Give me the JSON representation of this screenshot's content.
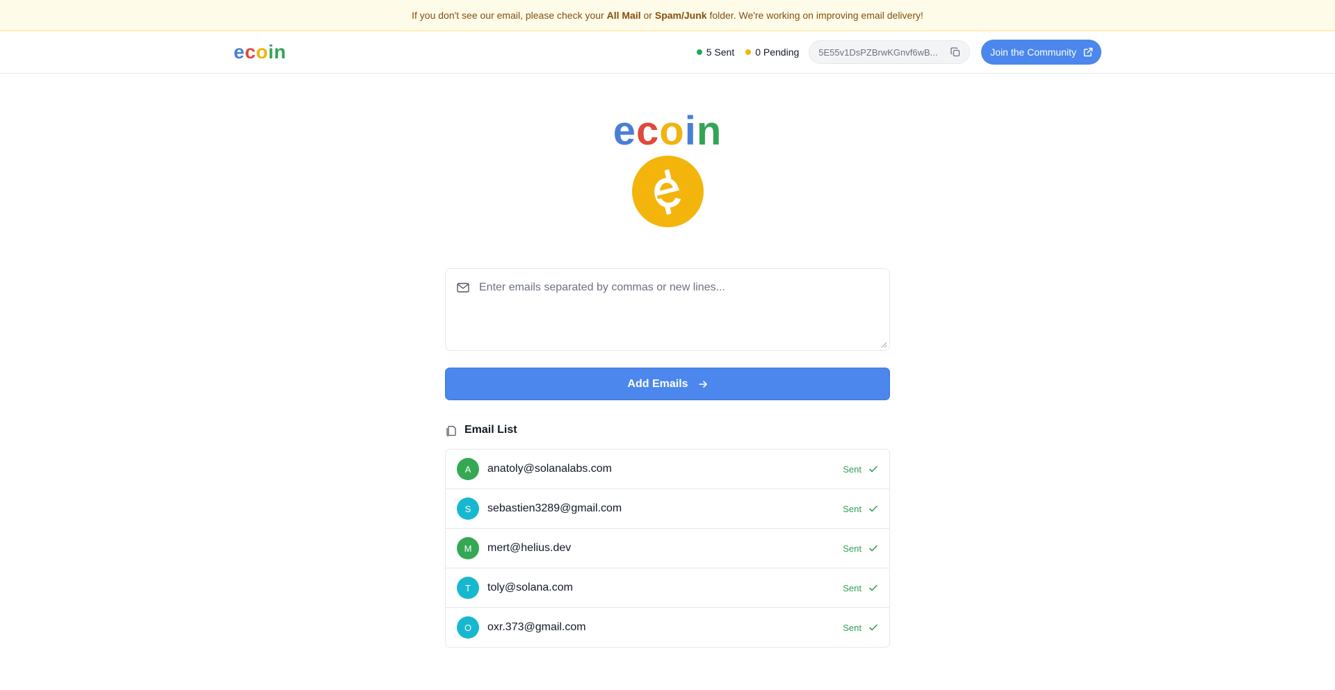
{
  "banner": {
    "prefix": "If you don't see our email, please check your ",
    "folder1": "All Mail",
    "middle": " or ",
    "folder2": "Spam/Junk",
    "suffix": " folder. We're working on improving email delivery!"
  },
  "header": {
    "brand": [
      "e",
      "c",
      "o",
      "in"
    ],
    "sent_label": "5 Sent",
    "pending_label": "0 Pending",
    "address": "5E55v1DsPZBrwKGnvf6wB...",
    "join_label": "Join the Community"
  },
  "hero": {
    "word": [
      "e",
      "c",
      "o",
      "i",
      "n"
    ]
  },
  "form": {
    "placeholder": "Enter emails separated by commas or new lines...",
    "add_label": "Add Emails"
  },
  "list": {
    "title": "Email List",
    "items": [
      {
        "initial": "A",
        "email": "anatoly@solanalabs.com",
        "status": "Sent",
        "color": "#34a853"
      },
      {
        "initial": "S",
        "email": "sebastien3289@gmail.com",
        "status": "Sent",
        "color": "#17b8cf"
      },
      {
        "initial": "M",
        "email": "mert@helius.dev",
        "status": "Sent",
        "color": "#34a853"
      },
      {
        "initial": "T",
        "email": "toly@solana.com",
        "status": "Sent",
        "color": "#17b8cf"
      },
      {
        "initial": "O",
        "email": "oxr.373@gmail.com",
        "status": "Sent",
        "color": "#17b8cf"
      }
    ]
  },
  "colors": {
    "primary": "#4b87ec",
    "success": "#2e9e58",
    "pending": "#f5b50a",
    "coin": "#f3b40c"
  }
}
